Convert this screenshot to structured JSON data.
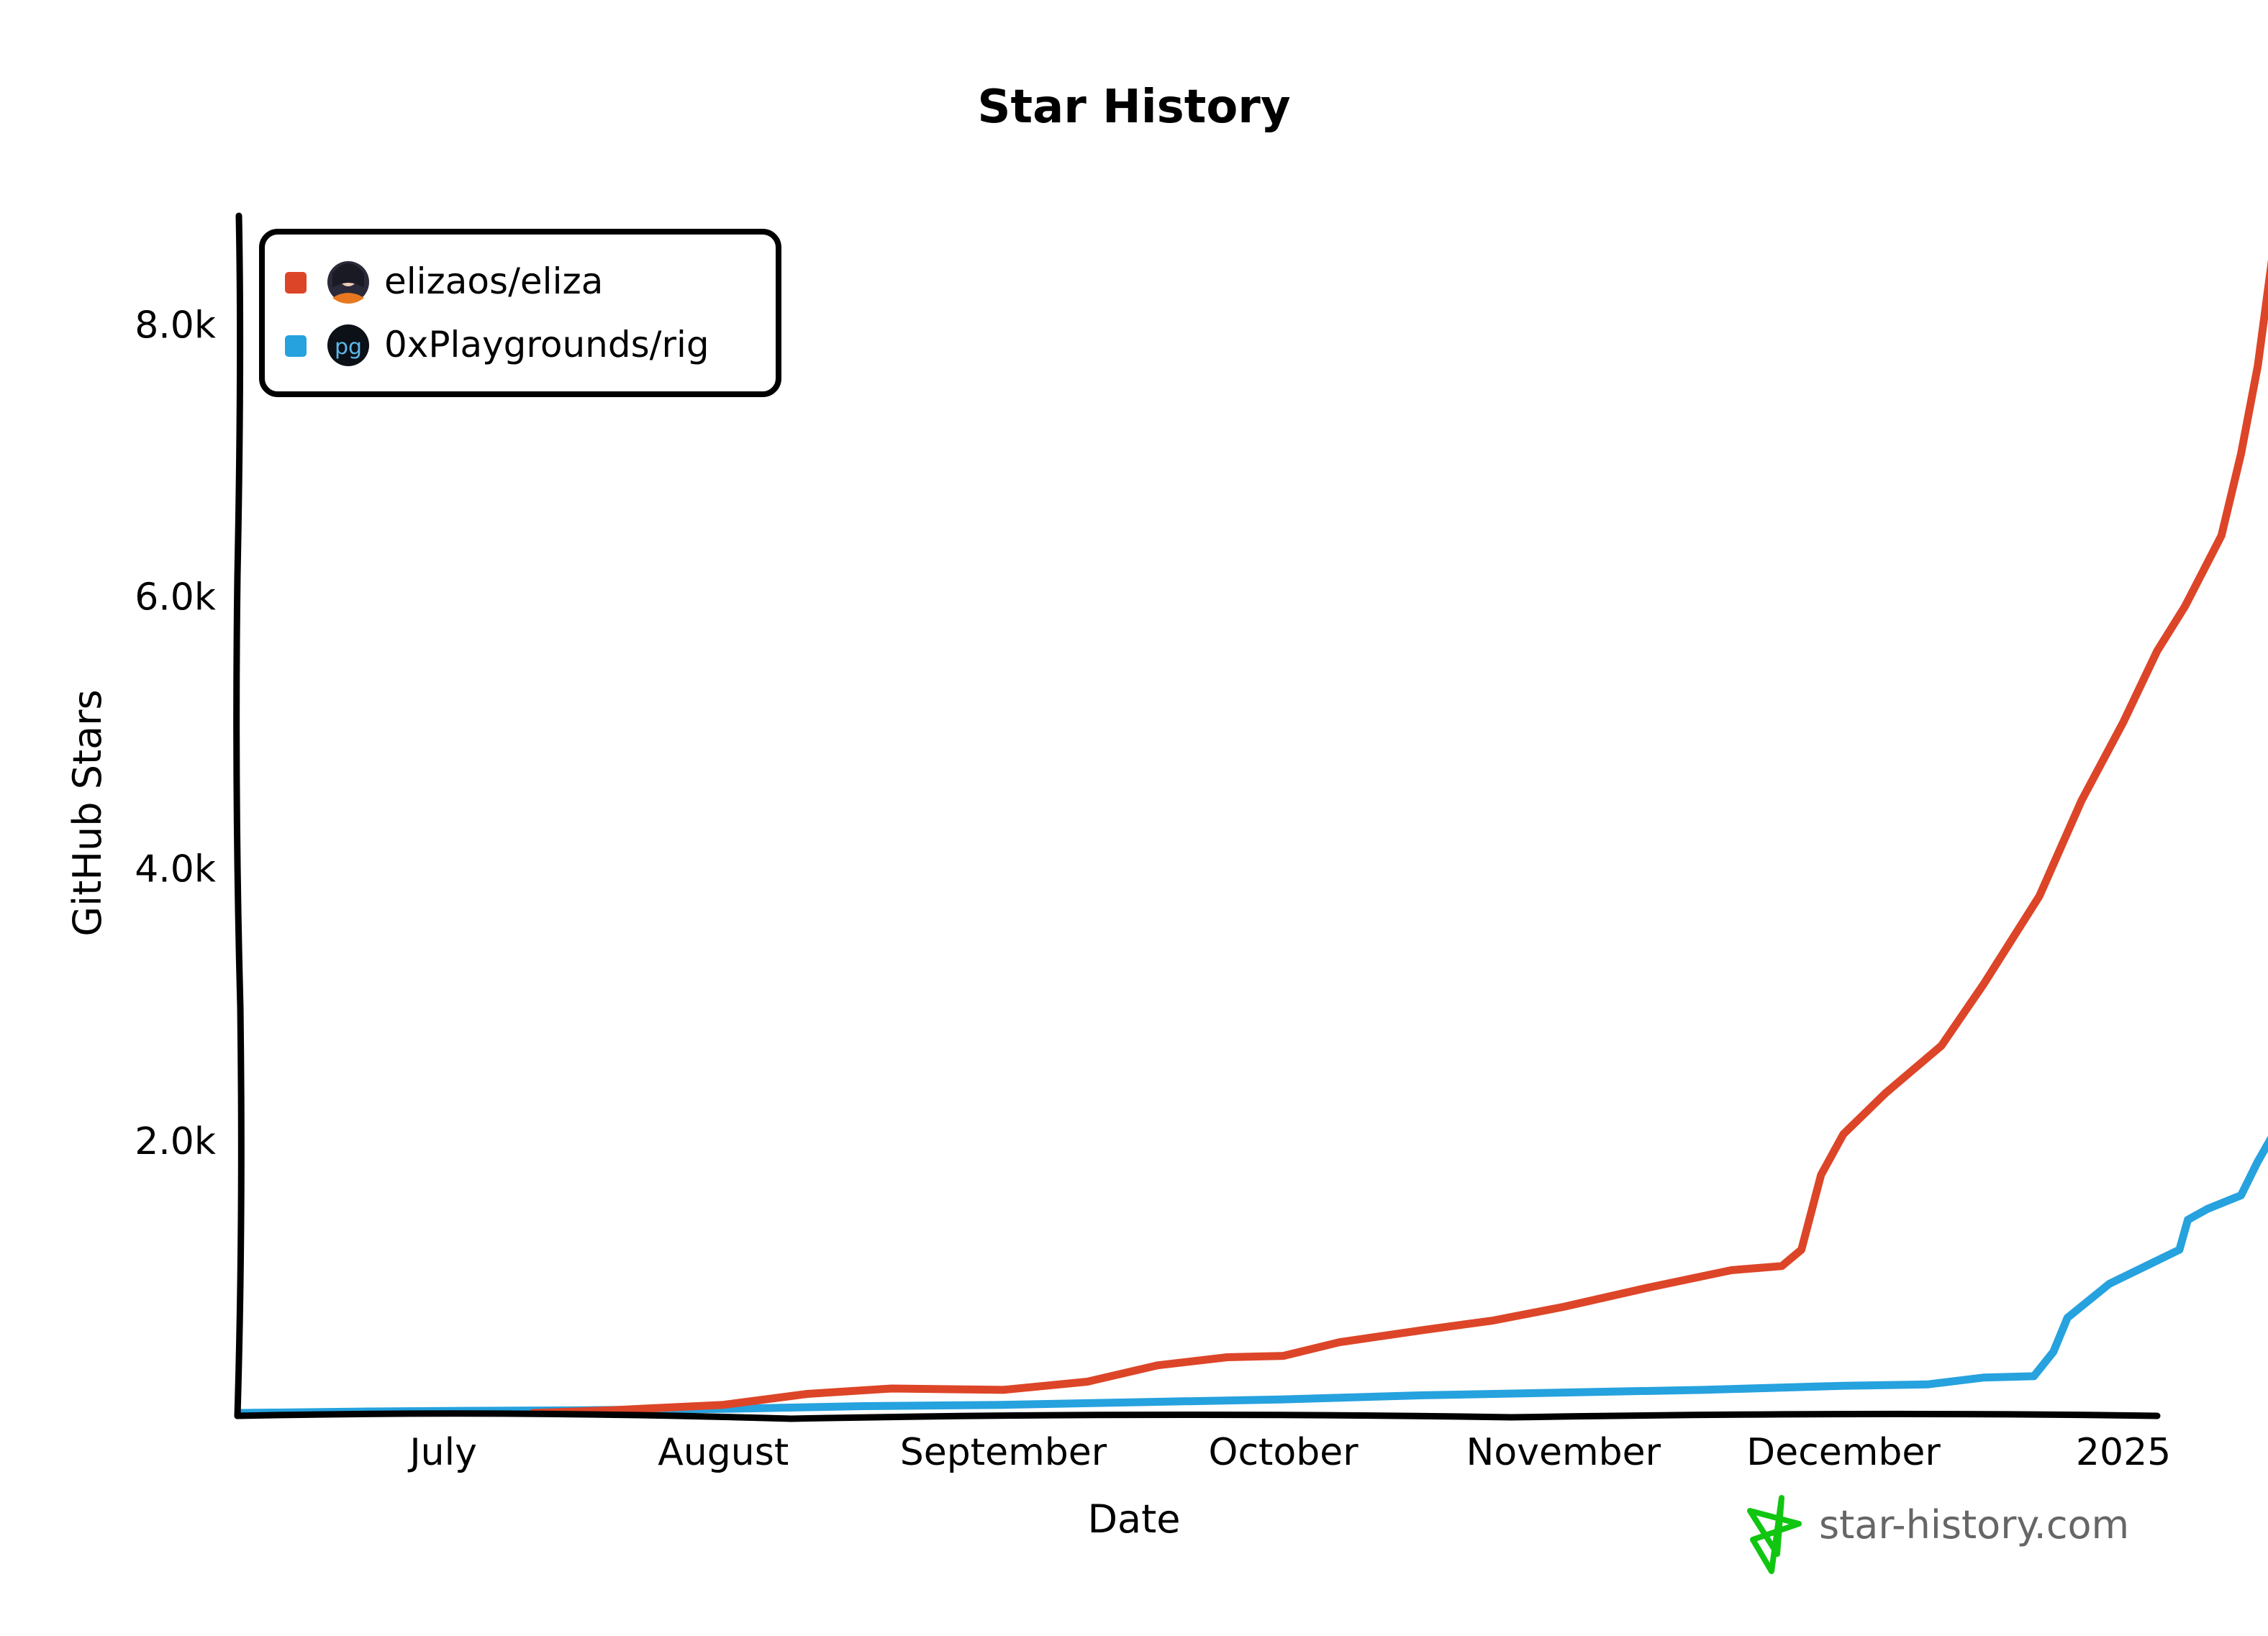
{
  "chart_data": {
    "type": "line",
    "title": "Star History",
    "xlabel": "Date",
    "ylabel": "GitHub Stars",
    "x_tick_labels": [
      "July",
      "August",
      "September",
      "October",
      "November",
      "December",
      "2025"
    ],
    "y_tick_labels": [
      "2.0k",
      "4.0k",
      "6.0k",
      "8.0k"
    ],
    "y_ticks": [
      2000,
      4000,
      6000,
      8000
    ],
    "ylim": [
      0,
      8800
    ],
    "xlim_months": [
      -0.73,
      6.1
    ],
    "x_units": "months since 2024-07-01",
    "grid": false,
    "legend_position": "top-left",
    "series": [
      {
        "name": "elizaos/eliza",
        "color": "#dd4528",
        "avatar": "anime-girl-avatar",
        "points": [
          [
            0.32,
            0
          ],
          [
            0.6,
            20
          ],
          [
            1.0,
            60
          ],
          [
            1.3,
            140
          ],
          [
            1.6,
            180
          ],
          [
            2.0,
            170
          ],
          [
            2.3,
            230
          ],
          [
            2.55,
            350
          ],
          [
            2.8,
            410
          ],
          [
            3.0,
            420
          ],
          [
            3.2,
            520
          ],
          [
            3.5,
            610
          ],
          [
            3.75,
            680
          ],
          [
            4.0,
            780
          ],
          [
            4.3,
            920
          ],
          [
            4.6,
            1050
          ],
          [
            4.78,
            1080
          ],
          [
            4.85,
            1200
          ],
          [
            4.92,
            1750
          ],
          [
            5.0,
            2050
          ],
          [
            5.15,
            2350
          ],
          [
            5.35,
            2700
          ],
          [
            5.5,
            3150
          ],
          [
            5.7,
            3800
          ],
          [
            5.85,
            4500
          ],
          [
            6.0,
            5080
          ],
          [
            6.12,
            5600
          ],
          [
            6.22,
            5930
          ],
          [
            6.35,
            6450
          ],
          [
            6.42,
            7050
          ],
          [
            6.48,
            7700
          ],
          [
            6.55,
            8780
          ]
        ]
      },
      {
        "name": "0xPlaygrounds/rig",
        "color": "#26a2de",
        "avatar": "pg-logo-avatar",
        "points": [
          [
            -0.73,
            0
          ],
          [
            -0.3,
            10
          ],
          [
            0.0,
            15
          ],
          [
            0.5,
            20
          ],
          [
            1.0,
            30
          ],
          [
            1.5,
            50
          ],
          [
            2.0,
            60
          ],
          [
            2.5,
            80
          ],
          [
            3.0,
            100
          ],
          [
            3.5,
            130
          ],
          [
            4.0,
            150
          ],
          [
            4.5,
            170
          ],
          [
            5.0,
            200
          ],
          [
            5.3,
            210
          ],
          [
            5.5,
            260
          ],
          [
            5.68,
            270
          ],
          [
            5.75,
            450
          ],
          [
            5.8,
            700
          ],
          [
            5.95,
            950
          ],
          [
            6.1,
            1100
          ],
          [
            6.2,
            1200
          ],
          [
            6.23,
            1420
          ],
          [
            6.3,
            1500
          ],
          [
            6.42,
            1600
          ],
          [
            6.48,
            1850
          ],
          [
            6.55,
            2100
          ],
          [
            6.6,
            2200
          ]
        ]
      }
    ]
  },
  "watermark": {
    "text": "star-history.com",
    "icon": "star-icon",
    "icon_color": "#11c611",
    "text_color": "#666666"
  }
}
